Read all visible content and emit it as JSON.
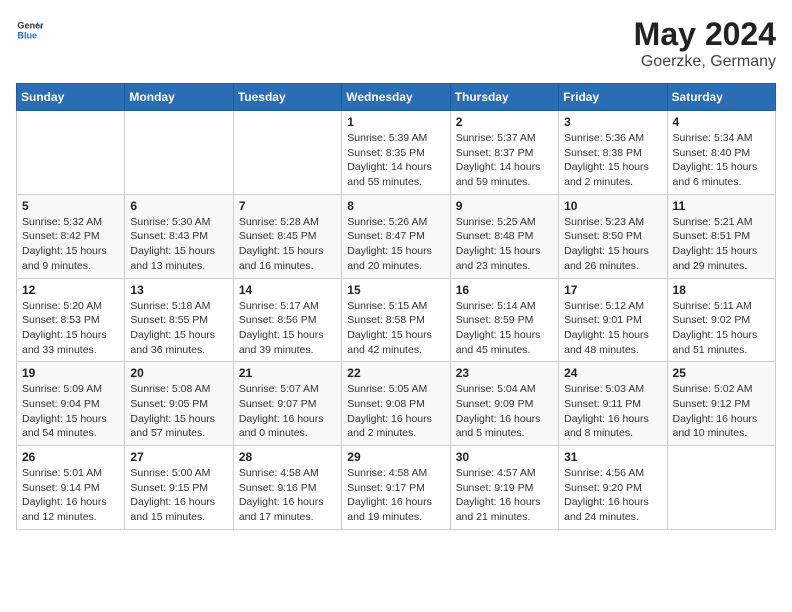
{
  "header": {
    "logo_general": "General",
    "logo_blue": "Blue",
    "month_year": "May 2024",
    "location": "Goerzke, Germany"
  },
  "days_of_week": [
    "Sunday",
    "Monday",
    "Tuesday",
    "Wednesday",
    "Thursday",
    "Friday",
    "Saturday"
  ],
  "weeks": [
    [
      {
        "day": "",
        "info": ""
      },
      {
        "day": "",
        "info": ""
      },
      {
        "day": "",
        "info": ""
      },
      {
        "day": "1",
        "info": "Sunrise: 5:39 AM\nSunset: 8:35 PM\nDaylight: 14 hours\nand 55 minutes."
      },
      {
        "day": "2",
        "info": "Sunrise: 5:37 AM\nSunset: 8:37 PM\nDaylight: 14 hours\nand 59 minutes."
      },
      {
        "day": "3",
        "info": "Sunrise: 5:36 AM\nSunset: 8:38 PM\nDaylight: 15 hours\nand 2 minutes."
      },
      {
        "day": "4",
        "info": "Sunrise: 5:34 AM\nSunset: 8:40 PM\nDaylight: 15 hours\nand 6 minutes."
      }
    ],
    [
      {
        "day": "5",
        "info": "Sunrise: 5:32 AM\nSunset: 8:42 PM\nDaylight: 15 hours\nand 9 minutes."
      },
      {
        "day": "6",
        "info": "Sunrise: 5:30 AM\nSunset: 8:43 PM\nDaylight: 15 hours\nand 13 minutes."
      },
      {
        "day": "7",
        "info": "Sunrise: 5:28 AM\nSunset: 8:45 PM\nDaylight: 15 hours\nand 16 minutes."
      },
      {
        "day": "8",
        "info": "Sunrise: 5:26 AM\nSunset: 8:47 PM\nDaylight: 15 hours\nand 20 minutes."
      },
      {
        "day": "9",
        "info": "Sunrise: 5:25 AM\nSunset: 8:48 PM\nDaylight: 15 hours\nand 23 minutes."
      },
      {
        "day": "10",
        "info": "Sunrise: 5:23 AM\nSunset: 8:50 PM\nDaylight: 15 hours\nand 26 minutes."
      },
      {
        "day": "11",
        "info": "Sunrise: 5:21 AM\nSunset: 8:51 PM\nDaylight: 15 hours\nand 29 minutes."
      }
    ],
    [
      {
        "day": "12",
        "info": "Sunrise: 5:20 AM\nSunset: 8:53 PM\nDaylight: 15 hours\nand 33 minutes."
      },
      {
        "day": "13",
        "info": "Sunrise: 5:18 AM\nSunset: 8:55 PM\nDaylight: 15 hours\nand 36 minutes."
      },
      {
        "day": "14",
        "info": "Sunrise: 5:17 AM\nSunset: 8:56 PM\nDaylight: 15 hours\nand 39 minutes."
      },
      {
        "day": "15",
        "info": "Sunrise: 5:15 AM\nSunset: 8:58 PM\nDaylight: 15 hours\nand 42 minutes."
      },
      {
        "day": "16",
        "info": "Sunrise: 5:14 AM\nSunset: 8:59 PM\nDaylight: 15 hours\nand 45 minutes."
      },
      {
        "day": "17",
        "info": "Sunrise: 5:12 AM\nSunset: 9:01 PM\nDaylight: 15 hours\nand 48 minutes."
      },
      {
        "day": "18",
        "info": "Sunrise: 5:11 AM\nSunset: 9:02 PM\nDaylight: 15 hours\nand 51 minutes."
      }
    ],
    [
      {
        "day": "19",
        "info": "Sunrise: 5:09 AM\nSunset: 9:04 PM\nDaylight: 15 hours\nand 54 minutes."
      },
      {
        "day": "20",
        "info": "Sunrise: 5:08 AM\nSunset: 9:05 PM\nDaylight: 15 hours\nand 57 minutes."
      },
      {
        "day": "21",
        "info": "Sunrise: 5:07 AM\nSunset: 9:07 PM\nDaylight: 16 hours\nand 0 minutes."
      },
      {
        "day": "22",
        "info": "Sunrise: 5:05 AM\nSunset: 9:08 PM\nDaylight: 16 hours\nand 2 minutes."
      },
      {
        "day": "23",
        "info": "Sunrise: 5:04 AM\nSunset: 9:09 PM\nDaylight: 16 hours\nand 5 minutes."
      },
      {
        "day": "24",
        "info": "Sunrise: 5:03 AM\nSunset: 9:11 PM\nDaylight: 16 hours\nand 8 minutes."
      },
      {
        "day": "25",
        "info": "Sunrise: 5:02 AM\nSunset: 9:12 PM\nDaylight: 16 hours\nand 10 minutes."
      }
    ],
    [
      {
        "day": "26",
        "info": "Sunrise: 5:01 AM\nSunset: 9:14 PM\nDaylight: 16 hours\nand 12 minutes."
      },
      {
        "day": "27",
        "info": "Sunrise: 5:00 AM\nSunset: 9:15 PM\nDaylight: 16 hours\nand 15 minutes."
      },
      {
        "day": "28",
        "info": "Sunrise: 4:58 AM\nSunset: 9:16 PM\nDaylight: 16 hours\nand 17 minutes."
      },
      {
        "day": "29",
        "info": "Sunrise: 4:58 AM\nSunset: 9:17 PM\nDaylight: 16 hours\nand 19 minutes."
      },
      {
        "day": "30",
        "info": "Sunrise: 4:57 AM\nSunset: 9:19 PM\nDaylight: 16 hours\nand 21 minutes."
      },
      {
        "day": "31",
        "info": "Sunrise: 4:56 AM\nSunset: 9:20 PM\nDaylight: 16 hours\nand 24 minutes."
      },
      {
        "day": "",
        "info": ""
      }
    ]
  ]
}
